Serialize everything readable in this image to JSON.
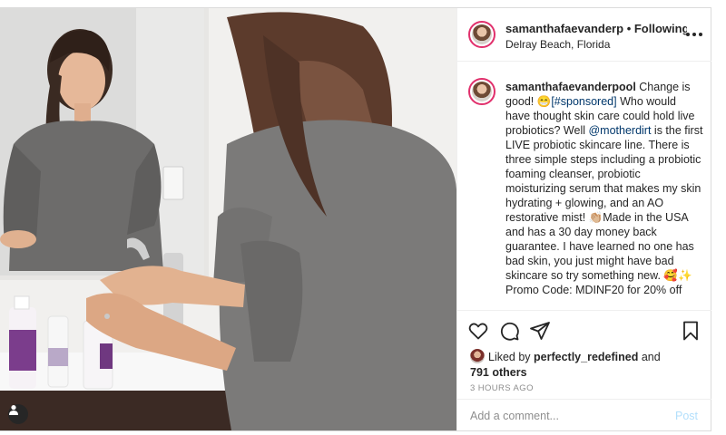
{
  "post": {
    "username": "samanthafaevanderpool",
    "header_username": "samanthafaevanderp",
    "follow_status": "• Following",
    "location": "Delray Beach, Florida",
    "caption": {
      "username": "samanthafaevanderpool",
      "text_1": " Change is good! 😁",
      "hashtag": "[#sponsored]",
      "text_2": " Who would have thought skin care could hold live probiotics? Well ",
      "mention": "@motherdirt",
      "text_3": " is the first LIVE probiotic skincare line. There is three simple steps including a probiotic foaming cleanser, probiotic moisturizing serum that makes my skin hydrating + glowing, and an AO restorative mist! 👏🏼Made in the USA and has a 30 day money back guarantee. I have learned no one has bad skin, you just might have bad skincare so try something new. 🥰✨ Promo Code: MDINF20 for 20% off"
    },
    "likes": {
      "liked_by_label": "Liked by ",
      "liked_by_user": "perfectly_redefined",
      "and_label": " and",
      "others": "791 others"
    },
    "timestamp": "3 HOURS AGO",
    "comment": {
      "placeholder": "Add a comment...",
      "value": "",
      "post_label": "Post"
    }
  },
  "icons": [
    "heart-icon",
    "comment-icon",
    "share-icon",
    "bookmark-icon",
    "more-options-icon",
    "user-tag-icon"
  ],
  "colors": {
    "text": "#262626",
    "secondary": "#8e8e8e",
    "link": "#00376b",
    "post_button_disabled": "#b2dffc",
    "story_ring": "#e1306c",
    "border": "#efefef"
  }
}
